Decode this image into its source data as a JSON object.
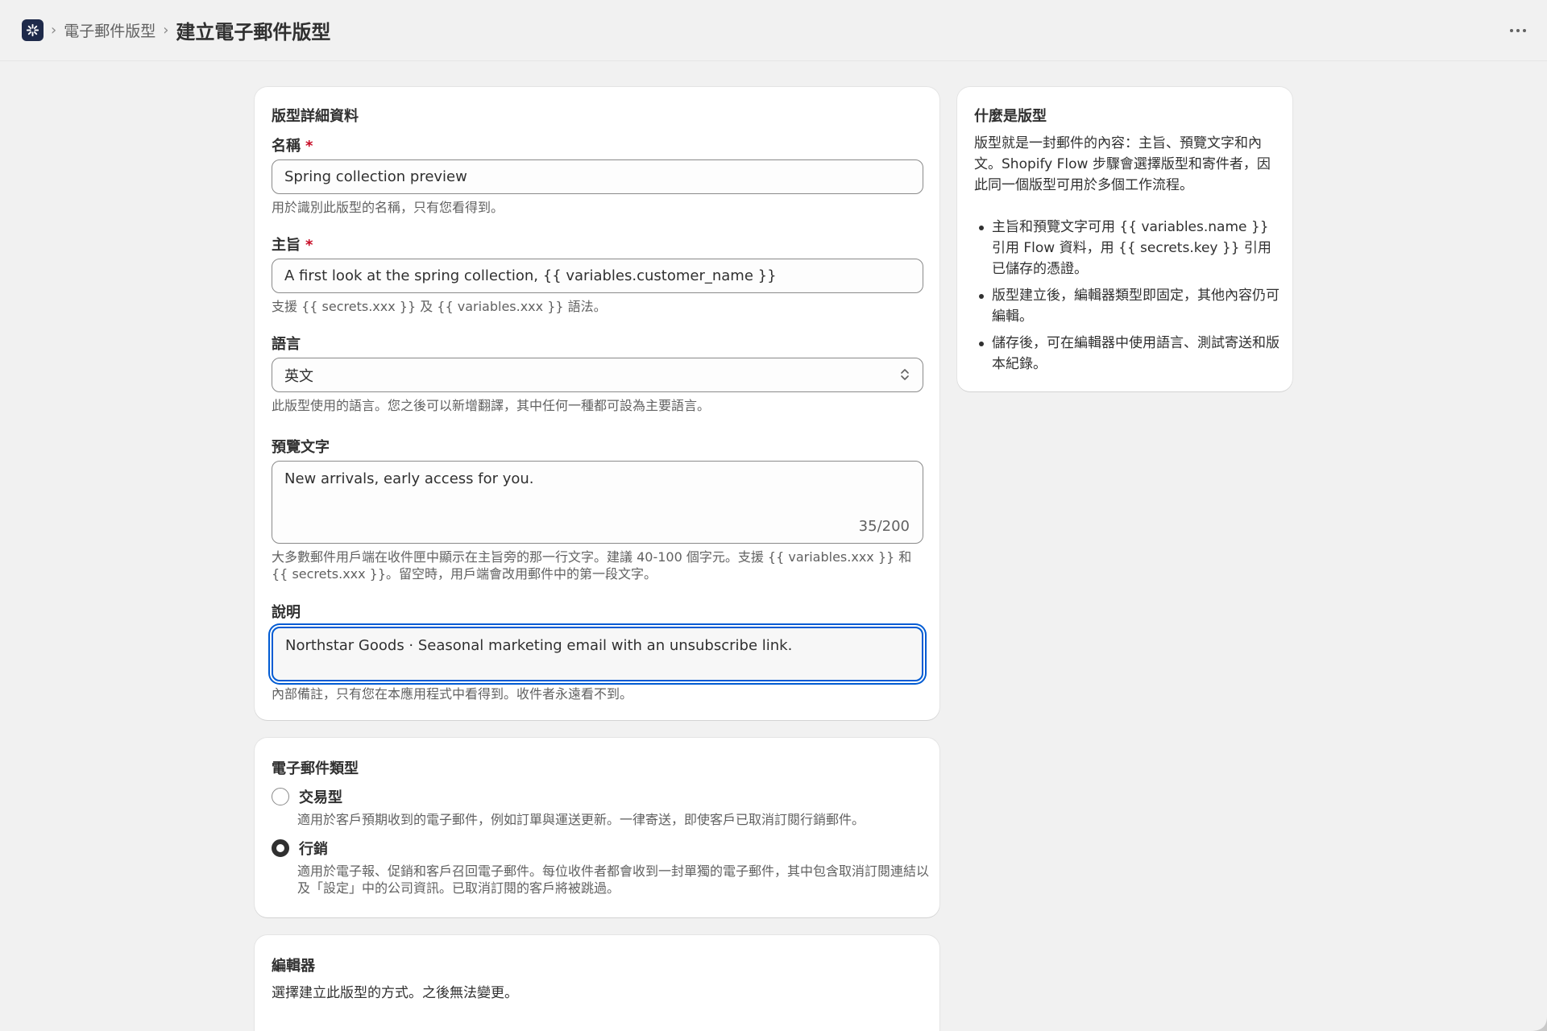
{
  "breadcrumb": {
    "parent": "電子郵件版型",
    "title": "建立電子郵件版型"
  },
  "details_card": {
    "title": "版型詳細資料",
    "name": {
      "label": "名稱",
      "required_mark": "*",
      "value": "Spring collection preview",
      "help": "用於識別此版型的名稱，只有您看得到。"
    },
    "subject": {
      "label": "主旨",
      "required_mark": "*",
      "value": "A first look at the spring collection, {{ variables.customer_name }}",
      "help": "支援 {{ secrets.xxx }} 及 {{ variables.xxx }} 語法。"
    },
    "language": {
      "label": "語言",
      "value": "英文",
      "help": "此版型使用的語言。您之後可以新增翻譯，其中任何一種都可設為主要語言。"
    },
    "preview_text": {
      "label": "預覽文字",
      "value": "New arrivals, early access for you.",
      "counter": "35/200",
      "help": "大多數郵件用戶端在收件匣中顯示在主旨旁的那一行文字。建議 40-100 個字元。支援 {{ variables.xxx }} 和 {{ secrets.xxx }}。留空時，用戶端會改用郵件中的第一段文字。"
    },
    "description": {
      "label": "說明",
      "value": "Northstar Goods · Seasonal marketing email with an unsubscribe link.",
      "help": "內部備註，只有您在本應用程式中看得到。收件者永遠看不到。"
    }
  },
  "email_type_card": {
    "title": "電子郵件類型",
    "options": [
      {
        "label": "交易型",
        "help": "適用於客戶預期收到的電子郵件，例如訂單與運送更新。一律寄送，即使客戶已取消訂閱行銷郵件。",
        "selected": false
      },
      {
        "label": "行銷",
        "help": "適用於電子報、促銷和客戶召回電子郵件。每位收件者都會收到一封單獨的電子郵件，其中包含取消訂閱連結以及「設定」中的公司資訊。已取消訂閱的客戶將被跳過。",
        "selected": true
      }
    ]
  },
  "editor_card": {
    "title": "編輯器",
    "help": "選擇建立此版型的方式。之後無法變更。"
  },
  "sidebar_card": {
    "title": "什麼是版型",
    "body": "版型就是一封郵件的內容：主旨、預覽文字和內文。Shopify Flow 步驟會選擇版型和寄件者，因此同一個版型可用於多個工作流程。",
    "bullets": [
      "主旨和預覽文字可用 {{ variables.name }} 引用 Flow 資料，用 {{ secrets.key }} 引用已儲存的憑證。",
      "版型建立後，編輯器類型即固定，其他內容仍可編輯。",
      "儲存後，可在編輯器中使用語言、測試寄送和版本紀錄。"
    ]
  },
  "icons": {
    "app": "app-logo-icon",
    "more": "more-horizontal-icon",
    "select": "select-chevrons-icon",
    "breadcrumb_sep": "chevron-right-icon"
  }
}
